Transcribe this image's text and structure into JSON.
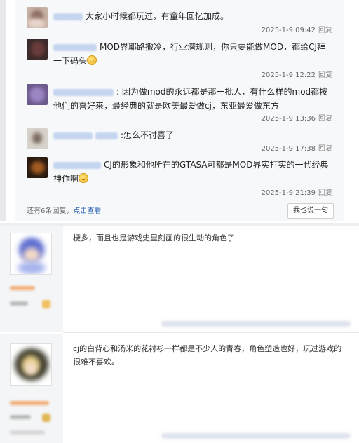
{
  "sub_replies": [
    {
      "text": "大家小时候都玩过，有童年回忆加成。",
      "time": "2025-1-9 09:42",
      "reply_label": "回复"
    },
    {
      "text": "MOD界耶路撒冷，行业潜规则，你只要能做MOD，都给CJ拜一下码头",
      "emoji": "smile-emoji-icon",
      "time": "2025-1-9 12:22",
      "reply_label": "回复"
    },
    {
      "text": ": 因为做mod的永远都是那一批人，有什么样的mod都按他们的喜好来，最经典的就是欧美最爱做cj，东亚最爱做东方",
      "time": "2025-1-9 13:36",
      "reply_label": "回复"
    },
    {
      "text": ":怎么不讨喜了",
      "time": "2025-1-9 17:38",
      "reply_label": "回复"
    },
    {
      "text": "CJ的形象和他所在的GTASA可都是MOD界实打实的一代经典神作啊",
      "emoji": "smile-emoji-icon",
      "time": "2025-1-9 21:39",
      "reply_label": "回复"
    }
  ],
  "more_replies": {
    "count_text": "还有6条回复，",
    "link_text": "点击查看"
  },
  "say_button": "我也说一句",
  "posts": [
    {
      "text": "梗多，而且也是游戏史里刻画的很生动的角色了"
    },
    {
      "text": "cj的白背心和汤米的花衬衫一样都是不少人的青春，角色塑造也好，玩过游戏的很难不喜欢。"
    }
  ],
  "colors": {
    "link": "#2d64b3",
    "panel_bg": "#f7f8fa",
    "username_blur": "#c5d5f0"
  }
}
